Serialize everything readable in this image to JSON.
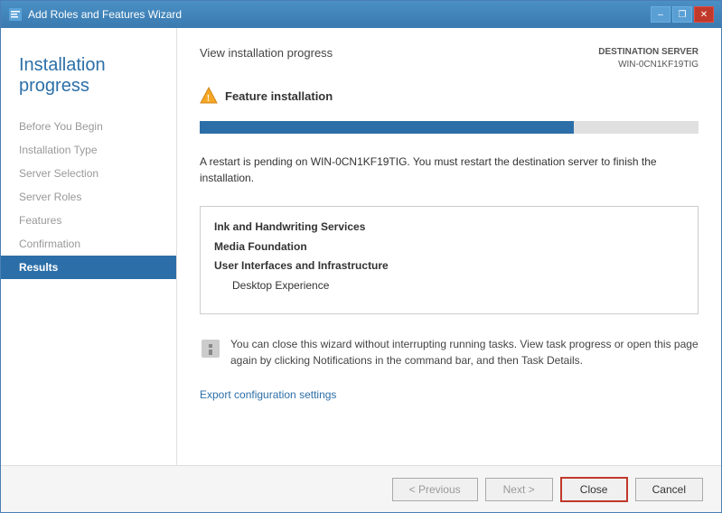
{
  "window": {
    "title": "Add Roles and Features Wizard",
    "icon": "wizard-icon"
  },
  "title_btn": {
    "minimize": "–",
    "restore": "❐",
    "close": "✕"
  },
  "sidebar": {
    "heading": "Installation progress",
    "items": [
      {
        "label": "Before You Begin",
        "state": "inactive"
      },
      {
        "label": "Installation Type",
        "state": "inactive"
      },
      {
        "label": "Server Selection",
        "state": "inactive"
      },
      {
        "label": "Server Roles",
        "state": "inactive"
      },
      {
        "label": "Features",
        "state": "inactive"
      },
      {
        "label": "Confirmation",
        "state": "inactive"
      },
      {
        "label": "Results",
        "state": "active"
      }
    ]
  },
  "destination_server": {
    "label": "DESTINATION SERVER",
    "value": "WIN-0CN1KF19TIG"
  },
  "section_title": "View installation progress",
  "feature_install": {
    "label": "Feature installation"
  },
  "progress": {
    "percent": 75
  },
  "warning_message": "A restart is pending on WIN-0CN1KF19TIG. You must restart the destination server to finish the installation.",
  "results": [
    {
      "text": "Ink and Handwriting Services",
      "bold": true,
      "indent": false
    },
    {
      "text": "Media Foundation",
      "bold": true,
      "indent": false
    },
    {
      "text": "User Interfaces and Infrastructure",
      "bold": true,
      "indent": false
    },
    {
      "text": "Desktop Experience",
      "bold": false,
      "indent": true
    }
  ],
  "info_text": "You can close this wizard without interrupting running tasks. View task progress or open this page again by clicking Notifications in the command bar, and then Task Details.",
  "export_link": "Export configuration settings",
  "footer": {
    "previous_label": "< Previous",
    "next_label": "Next >",
    "close_label": "Close",
    "cancel_label": "Cancel"
  }
}
